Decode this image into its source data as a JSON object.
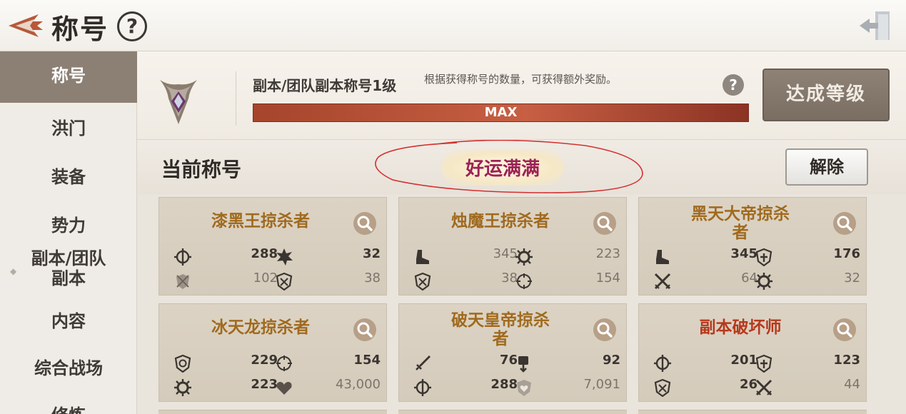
{
  "header": {
    "title": "称号",
    "help": "?"
  },
  "sidebar": {
    "items": [
      {
        "label": "称号"
      },
      {
        "label": "洪门"
      },
      {
        "label": "装备"
      },
      {
        "label": "势力"
      },
      {
        "label": "副本/团队\n副本"
      },
      {
        "label": "内容"
      },
      {
        "label": "综合战场"
      },
      {
        "label": "修炼"
      }
    ]
  },
  "achievement": {
    "title": "副本/团队副本称号1级",
    "desc": "根据获得称号的数量，可获得额外奖励。",
    "help": "?",
    "progress_text": "MAX",
    "progress_fraction": 1.0,
    "button": "达成等级"
  },
  "current": {
    "label": "当前称号",
    "title": "好运满满",
    "remove": "解除"
  },
  "cards": [
    {
      "name": "漆黑王掠杀者",
      "stats": [
        {
          "icon": "shield-target-icon",
          "value": "288"
        },
        {
          "icon": "burst-icon",
          "value": "32"
        },
        {
          "icon": "crossed-swords-shield-icon",
          "value": "102"
        },
        {
          "icon": "shield-cross-icon",
          "value": "38"
        }
      ]
    },
    {
      "name": "烛魔王掠杀者",
      "stats": [
        {
          "icon": "boot-icon",
          "value": "345"
        },
        {
          "icon": "gear-icon",
          "value": "223"
        },
        {
          "icon": "shield-cross-icon",
          "value": "38"
        },
        {
          "icon": "crosshair-icon",
          "value": "154"
        }
      ]
    },
    {
      "name": "黑天大帝掠杀\n者",
      "stats": [
        {
          "icon": "boot-icon",
          "value": "345"
        },
        {
          "icon": "shield-plus-icon",
          "value": "176"
        },
        {
          "icon": "crossed-swords-icon",
          "value": "64"
        },
        {
          "icon": "gear-icon",
          "value": "32"
        }
      ]
    },
    {
      "name": "冰天龙掠杀者",
      "stats": [
        {
          "icon": "shield-ring-icon",
          "value": "229"
        },
        {
          "icon": "crosshair-icon",
          "value": "154"
        },
        {
          "icon": "gear-icon",
          "value": "223"
        },
        {
          "icon": "heart-icon",
          "value": "43,000"
        }
      ]
    },
    {
      "name": "破天皇帝掠杀\n者",
      "stats": [
        {
          "icon": "sword-icon",
          "value": "76"
        },
        {
          "icon": "fist-down-icon",
          "value": "92"
        },
        {
          "icon": "shield-target-icon",
          "value": "288"
        },
        {
          "icon": "shield-heart-icon",
          "value": "7,091"
        }
      ]
    },
    {
      "name": "副本破坏师",
      "stats": [
        {
          "icon": "shield-target-icon",
          "value": "201"
        },
        {
          "icon": "shield-plus-icon",
          "value": "123"
        },
        {
          "icon": "shield-cross-icon",
          "value": "26"
        },
        {
          "icon": "crossed-swords-icon",
          "value": "44"
        }
      ]
    }
  ],
  "colors": {
    "accent": "#8c8074",
    "progress": "#a5452c",
    "title_gold": "#a06a1e",
    "title_red": "#b6391d",
    "current_title": "#9b2255"
  }
}
